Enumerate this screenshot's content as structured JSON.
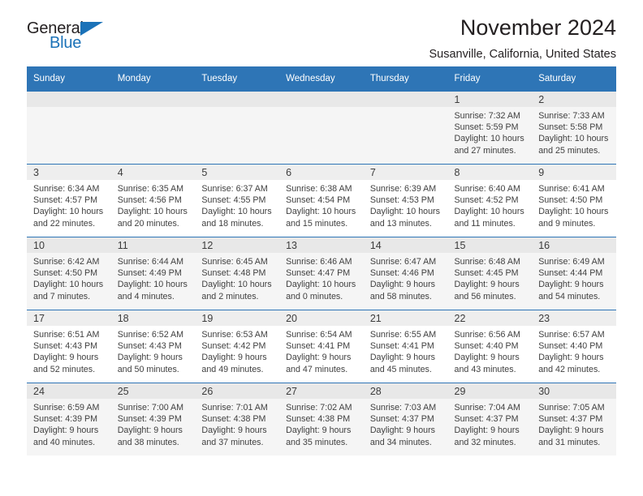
{
  "brand": {
    "name_part1": "General",
    "name_part2": "Blue"
  },
  "header": {
    "title": "November 2024",
    "location": "Susanville, California, United States"
  },
  "colors": {
    "header_blue": "#2e75b6",
    "brand_blue": "#1b72b8",
    "day_band": "#eeeeee",
    "alt_row": "#f5f5f5"
  },
  "weekdays": [
    "Sunday",
    "Monday",
    "Tuesday",
    "Wednesday",
    "Thursday",
    "Friday",
    "Saturday"
  ],
  "weeks": [
    [
      {
        "day": "",
        "empty": true
      },
      {
        "day": "",
        "empty": true
      },
      {
        "day": "",
        "empty": true
      },
      {
        "day": "",
        "empty": true
      },
      {
        "day": "",
        "empty": true
      },
      {
        "day": "1",
        "sunrise": "Sunrise: 7:32 AM",
        "sunset": "Sunset: 5:59 PM",
        "daylight_l1": "Daylight: 10 hours",
        "daylight_l2": "and 27 minutes."
      },
      {
        "day": "2",
        "sunrise": "Sunrise: 7:33 AM",
        "sunset": "Sunset: 5:58 PM",
        "daylight_l1": "Daylight: 10 hours",
        "daylight_l2": "and 25 minutes."
      }
    ],
    [
      {
        "day": "3",
        "sunrise": "Sunrise: 6:34 AM",
        "sunset": "Sunset: 4:57 PM",
        "daylight_l1": "Daylight: 10 hours",
        "daylight_l2": "and 22 minutes."
      },
      {
        "day": "4",
        "sunrise": "Sunrise: 6:35 AM",
        "sunset": "Sunset: 4:56 PM",
        "daylight_l1": "Daylight: 10 hours",
        "daylight_l2": "and 20 minutes."
      },
      {
        "day": "5",
        "sunrise": "Sunrise: 6:37 AM",
        "sunset": "Sunset: 4:55 PM",
        "daylight_l1": "Daylight: 10 hours",
        "daylight_l2": "and 18 minutes."
      },
      {
        "day": "6",
        "sunrise": "Sunrise: 6:38 AM",
        "sunset": "Sunset: 4:54 PM",
        "daylight_l1": "Daylight: 10 hours",
        "daylight_l2": "and 15 minutes."
      },
      {
        "day": "7",
        "sunrise": "Sunrise: 6:39 AM",
        "sunset": "Sunset: 4:53 PM",
        "daylight_l1": "Daylight: 10 hours",
        "daylight_l2": "and 13 minutes."
      },
      {
        "day": "8",
        "sunrise": "Sunrise: 6:40 AM",
        "sunset": "Sunset: 4:52 PM",
        "daylight_l1": "Daylight: 10 hours",
        "daylight_l2": "and 11 minutes."
      },
      {
        "day": "9",
        "sunrise": "Sunrise: 6:41 AM",
        "sunset": "Sunset: 4:50 PM",
        "daylight_l1": "Daylight: 10 hours",
        "daylight_l2": "and 9 minutes."
      }
    ],
    [
      {
        "day": "10",
        "sunrise": "Sunrise: 6:42 AM",
        "sunset": "Sunset: 4:50 PM",
        "daylight_l1": "Daylight: 10 hours",
        "daylight_l2": "and 7 minutes."
      },
      {
        "day": "11",
        "sunrise": "Sunrise: 6:44 AM",
        "sunset": "Sunset: 4:49 PM",
        "daylight_l1": "Daylight: 10 hours",
        "daylight_l2": "and 4 minutes."
      },
      {
        "day": "12",
        "sunrise": "Sunrise: 6:45 AM",
        "sunset": "Sunset: 4:48 PM",
        "daylight_l1": "Daylight: 10 hours",
        "daylight_l2": "and 2 minutes."
      },
      {
        "day": "13",
        "sunrise": "Sunrise: 6:46 AM",
        "sunset": "Sunset: 4:47 PM",
        "daylight_l1": "Daylight: 10 hours",
        "daylight_l2": "and 0 minutes."
      },
      {
        "day": "14",
        "sunrise": "Sunrise: 6:47 AM",
        "sunset": "Sunset: 4:46 PM",
        "daylight_l1": "Daylight: 9 hours",
        "daylight_l2": "and 58 minutes."
      },
      {
        "day": "15",
        "sunrise": "Sunrise: 6:48 AM",
        "sunset": "Sunset: 4:45 PM",
        "daylight_l1": "Daylight: 9 hours",
        "daylight_l2": "and 56 minutes."
      },
      {
        "day": "16",
        "sunrise": "Sunrise: 6:49 AM",
        "sunset": "Sunset: 4:44 PM",
        "daylight_l1": "Daylight: 9 hours",
        "daylight_l2": "and 54 minutes."
      }
    ],
    [
      {
        "day": "17",
        "sunrise": "Sunrise: 6:51 AM",
        "sunset": "Sunset: 4:43 PM",
        "daylight_l1": "Daylight: 9 hours",
        "daylight_l2": "and 52 minutes."
      },
      {
        "day": "18",
        "sunrise": "Sunrise: 6:52 AM",
        "sunset": "Sunset: 4:43 PM",
        "daylight_l1": "Daylight: 9 hours",
        "daylight_l2": "and 50 minutes."
      },
      {
        "day": "19",
        "sunrise": "Sunrise: 6:53 AM",
        "sunset": "Sunset: 4:42 PM",
        "daylight_l1": "Daylight: 9 hours",
        "daylight_l2": "and 49 minutes."
      },
      {
        "day": "20",
        "sunrise": "Sunrise: 6:54 AM",
        "sunset": "Sunset: 4:41 PM",
        "daylight_l1": "Daylight: 9 hours",
        "daylight_l2": "and 47 minutes."
      },
      {
        "day": "21",
        "sunrise": "Sunrise: 6:55 AM",
        "sunset": "Sunset: 4:41 PM",
        "daylight_l1": "Daylight: 9 hours",
        "daylight_l2": "and 45 minutes."
      },
      {
        "day": "22",
        "sunrise": "Sunrise: 6:56 AM",
        "sunset": "Sunset: 4:40 PM",
        "daylight_l1": "Daylight: 9 hours",
        "daylight_l2": "and 43 minutes."
      },
      {
        "day": "23",
        "sunrise": "Sunrise: 6:57 AM",
        "sunset": "Sunset: 4:40 PM",
        "daylight_l1": "Daylight: 9 hours",
        "daylight_l2": "and 42 minutes."
      }
    ],
    [
      {
        "day": "24",
        "sunrise": "Sunrise: 6:59 AM",
        "sunset": "Sunset: 4:39 PM",
        "daylight_l1": "Daylight: 9 hours",
        "daylight_l2": "and 40 minutes."
      },
      {
        "day": "25",
        "sunrise": "Sunrise: 7:00 AM",
        "sunset": "Sunset: 4:39 PM",
        "daylight_l1": "Daylight: 9 hours",
        "daylight_l2": "and 38 minutes."
      },
      {
        "day": "26",
        "sunrise": "Sunrise: 7:01 AM",
        "sunset": "Sunset: 4:38 PM",
        "daylight_l1": "Daylight: 9 hours",
        "daylight_l2": "and 37 minutes."
      },
      {
        "day": "27",
        "sunrise": "Sunrise: 7:02 AM",
        "sunset": "Sunset: 4:38 PM",
        "daylight_l1": "Daylight: 9 hours",
        "daylight_l2": "and 35 minutes."
      },
      {
        "day": "28",
        "sunrise": "Sunrise: 7:03 AM",
        "sunset": "Sunset: 4:37 PM",
        "daylight_l1": "Daylight: 9 hours",
        "daylight_l2": "and 34 minutes."
      },
      {
        "day": "29",
        "sunrise": "Sunrise: 7:04 AM",
        "sunset": "Sunset: 4:37 PM",
        "daylight_l1": "Daylight: 9 hours",
        "daylight_l2": "and 32 minutes."
      },
      {
        "day": "30",
        "sunrise": "Sunrise: 7:05 AM",
        "sunset": "Sunset: 4:37 PM",
        "daylight_l1": "Daylight: 9 hours",
        "daylight_l2": "and 31 minutes."
      }
    ]
  ]
}
